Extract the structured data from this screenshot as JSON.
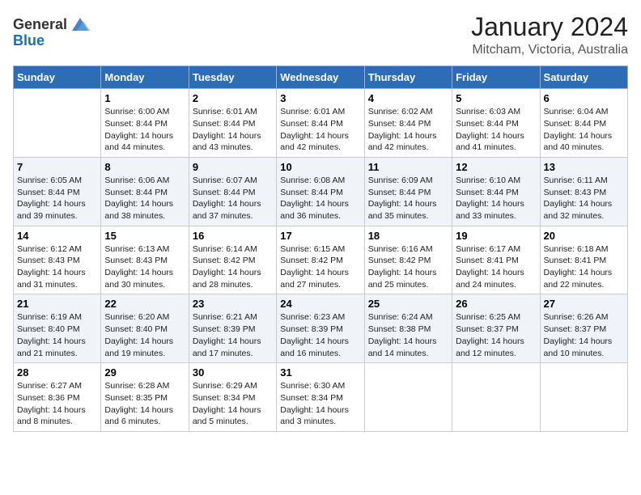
{
  "logo": {
    "general": "General",
    "blue": "Blue"
  },
  "title": "January 2024",
  "location": "Mitcham, Victoria, Australia",
  "days_of_week": [
    "Sunday",
    "Monday",
    "Tuesday",
    "Wednesday",
    "Thursday",
    "Friday",
    "Saturday"
  ],
  "weeks": [
    [
      {
        "day": "",
        "sunrise": "",
        "sunset": "",
        "daylight": ""
      },
      {
        "day": "1",
        "sunrise": "Sunrise: 6:00 AM",
        "sunset": "Sunset: 8:44 PM",
        "daylight": "Daylight: 14 hours and 44 minutes."
      },
      {
        "day": "2",
        "sunrise": "Sunrise: 6:01 AM",
        "sunset": "Sunset: 8:44 PM",
        "daylight": "Daylight: 14 hours and 43 minutes."
      },
      {
        "day": "3",
        "sunrise": "Sunrise: 6:01 AM",
        "sunset": "Sunset: 8:44 PM",
        "daylight": "Daylight: 14 hours and 42 minutes."
      },
      {
        "day": "4",
        "sunrise": "Sunrise: 6:02 AM",
        "sunset": "Sunset: 8:44 PM",
        "daylight": "Daylight: 14 hours and 42 minutes."
      },
      {
        "day": "5",
        "sunrise": "Sunrise: 6:03 AM",
        "sunset": "Sunset: 8:44 PM",
        "daylight": "Daylight: 14 hours and 41 minutes."
      },
      {
        "day": "6",
        "sunrise": "Sunrise: 6:04 AM",
        "sunset": "Sunset: 8:44 PM",
        "daylight": "Daylight: 14 hours and 40 minutes."
      }
    ],
    [
      {
        "day": "7",
        "sunrise": "Sunrise: 6:05 AM",
        "sunset": "Sunset: 8:44 PM",
        "daylight": "Daylight: 14 hours and 39 minutes."
      },
      {
        "day": "8",
        "sunrise": "Sunrise: 6:06 AM",
        "sunset": "Sunset: 8:44 PM",
        "daylight": "Daylight: 14 hours and 38 minutes."
      },
      {
        "day": "9",
        "sunrise": "Sunrise: 6:07 AM",
        "sunset": "Sunset: 8:44 PM",
        "daylight": "Daylight: 14 hours and 37 minutes."
      },
      {
        "day": "10",
        "sunrise": "Sunrise: 6:08 AM",
        "sunset": "Sunset: 8:44 PM",
        "daylight": "Daylight: 14 hours and 36 minutes."
      },
      {
        "day": "11",
        "sunrise": "Sunrise: 6:09 AM",
        "sunset": "Sunset: 8:44 PM",
        "daylight": "Daylight: 14 hours and 35 minutes."
      },
      {
        "day": "12",
        "sunrise": "Sunrise: 6:10 AM",
        "sunset": "Sunset: 8:44 PM",
        "daylight": "Daylight: 14 hours and 33 minutes."
      },
      {
        "day": "13",
        "sunrise": "Sunrise: 6:11 AM",
        "sunset": "Sunset: 8:43 PM",
        "daylight": "Daylight: 14 hours and 32 minutes."
      }
    ],
    [
      {
        "day": "14",
        "sunrise": "Sunrise: 6:12 AM",
        "sunset": "Sunset: 8:43 PM",
        "daylight": "Daylight: 14 hours and 31 minutes."
      },
      {
        "day": "15",
        "sunrise": "Sunrise: 6:13 AM",
        "sunset": "Sunset: 8:43 PM",
        "daylight": "Daylight: 14 hours and 30 minutes."
      },
      {
        "day": "16",
        "sunrise": "Sunrise: 6:14 AM",
        "sunset": "Sunset: 8:42 PM",
        "daylight": "Daylight: 14 hours and 28 minutes."
      },
      {
        "day": "17",
        "sunrise": "Sunrise: 6:15 AM",
        "sunset": "Sunset: 8:42 PM",
        "daylight": "Daylight: 14 hours and 27 minutes."
      },
      {
        "day": "18",
        "sunrise": "Sunrise: 6:16 AM",
        "sunset": "Sunset: 8:42 PM",
        "daylight": "Daylight: 14 hours and 25 minutes."
      },
      {
        "day": "19",
        "sunrise": "Sunrise: 6:17 AM",
        "sunset": "Sunset: 8:41 PM",
        "daylight": "Daylight: 14 hours and 24 minutes."
      },
      {
        "day": "20",
        "sunrise": "Sunrise: 6:18 AM",
        "sunset": "Sunset: 8:41 PM",
        "daylight": "Daylight: 14 hours and 22 minutes."
      }
    ],
    [
      {
        "day": "21",
        "sunrise": "Sunrise: 6:19 AM",
        "sunset": "Sunset: 8:40 PM",
        "daylight": "Daylight: 14 hours and 21 minutes."
      },
      {
        "day": "22",
        "sunrise": "Sunrise: 6:20 AM",
        "sunset": "Sunset: 8:40 PM",
        "daylight": "Daylight: 14 hours and 19 minutes."
      },
      {
        "day": "23",
        "sunrise": "Sunrise: 6:21 AM",
        "sunset": "Sunset: 8:39 PM",
        "daylight": "Daylight: 14 hours and 17 minutes."
      },
      {
        "day": "24",
        "sunrise": "Sunrise: 6:23 AM",
        "sunset": "Sunset: 8:39 PM",
        "daylight": "Daylight: 14 hours and 16 minutes."
      },
      {
        "day": "25",
        "sunrise": "Sunrise: 6:24 AM",
        "sunset": "Sunset: 8:38 PM",
        "daylight": "Daylight: 14 hours and 14 minutes."
      },
      {
        "day": "26",
        "sunrise": "Sunrise: 6:25 AM",
        "sunset": "Sunset: 8:37 PM",
        "daylight": "Daylight: 14 hours and 12 minutes."
      },
      {
        "day": "27",
        "sunrise": "Sunrise: 6:26 AM",
        "sunset": "Sunset: 8:37 PM",
        "daylight": "Daylight: 14 hours and 10 minutes."
      }
    ],
    [
      {
        "day": "28",
        "sunrise": "Sunrise: 6:27 AM",
        "sunset": "Sunset: 8:36 PM",
        "daylight": "Daylight: 14 hours and 8 minutes."
      },
      {
        "day": "29",
        "sunrise": "Sunrise: 6:28 AM",
        "sunset": "Sunset: 8:35 PM",
        "daylight": "Daylight: 14 hours and 6 minutes."
      },
      {
        "day": "30",
        "sunrise": "Sunrise: 6:29 AM",
        "sunset": "Sunset: 8:34 PM",
        "daylight": "Daylight: 14 hours and 5 minutes."
      },
      {
        "day": "31",
        "sunrise": "Sunrise: 6:30 AM",
        "sunset": "Sunset: 8:34 PM",
        "daylight": "Daylight: 14 hours and 3 minutes."
      },
      {
        "day": "",
        "sunrise": "",
        "sunset": "",
        "daylight": ""
      },
      {
        "day": "",
        "sunrise": "",
        "sunset": "",
        "daylight": ""
      },
      {
        "day": "",
        "sunrise": "",
        "sunset": "",
        "daylight": ""
      }
    ]
  ]
}
